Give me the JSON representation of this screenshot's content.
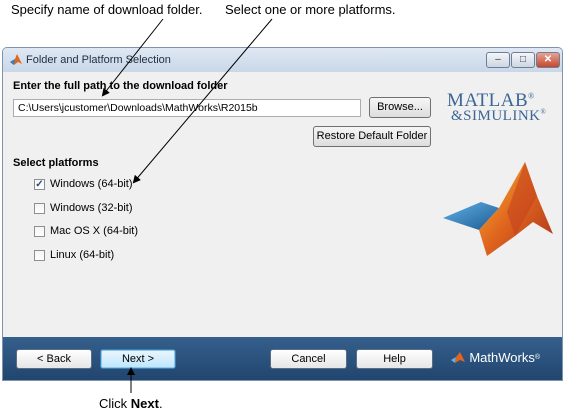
{
  "callouts": {
    "folder": "Specify name of download folder.",
    "platforms": "Select one or more platforms.",
    "click_prefix": "Click ",
    "click_bold": "Next",
    "click_suffix": "."
  },
  "window": {
    "title": "Folder and Platform Selection",
    "minimize": "–",
    "maximize": "□",
    "close": "✕"
  },
  "folder": {
    "label": "Enter the full path to the download folder",
    "path_value": "C:\\Users\\jcustomer\\Downloads\\MathWorks\\R2015b",
    "browse_label": "Browse...",
    "restore_label": "Restore Default Folder"
  },
  "platforms": {
    "label": "Select platforms",
    "items": [
      {
        "label": "Windows (64-bit)",
        "checked": true
      },
      {
        "label": "Windows (32-bit)",
        "checked": false
      },
      {
        "label": "Mac OS X (64-bit)",
        "checked": false
      },
      {
        "label": "Linux (64-bit)",
        "checked": false
      }
    ]
  },
  "branding": {
    "matlab": "MATLAB",
    "simulink": "SIMULINK",
    "reg": "®",
    "mathworks": "MathWorks",
    "accent_blue": "#3c6696",
    "peak_orange": "#e0651e",
    "surface_blue": "#2f7fc1"
  },
  "nav": {
    "back": "< Back",
    "next": "Next >",
    "cancel": "Cancel",
    "help": "Help"
  },
  "colors": {
    "bottom_bar": "#2b5280",
    "title_bar": "#d5e1ef"
  }
}
